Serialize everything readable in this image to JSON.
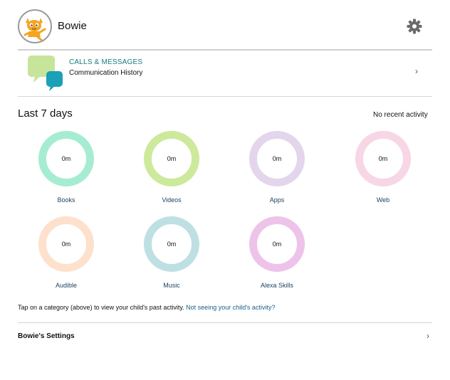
{
  "header": {
    "name": "Bowie",
    "avatar_icon": "cartoon-cat-avatar-icon",
    "settings_icon": "gear-icon"
  },
  "calls": {
    "title": "CALLS & MESSAGES",
    "subtitle": "Communication History",
    "chevron": "›"
  },
  "activity": {
    "title": "Last 7 days",
    "status": "No recent activity"
  },
  "categories": [
    {
      "label": "Books",
      "value": "0m",
      "color": "#a6ecd2"
    },
    {
      "label": "Videos",
      "value": "0m",
      "color": "#cde99b"
    },
    {
      "label": "Apps",
      "value": "0m",
      "color": "#e3d6ec"
    },
    {
      "label": "Web",
      "value": "0m",
      "color": "#f7d6e6"
    },
    {
      "label": "Audible",
      "value": "0m",
      "color": "#fde1cc"
    },
    {
      "label": "Music",
      "value": "0m",
      "color": "#bfe0e3"
    },
    {
      "label": "Alexa Skills",
      "value": "0m",
      "color": "#eec3ea"
    }
  ],
  "help": {
    "text": "Tap on a category (above) to view your child's past activity.",
    "link": "Not seeing your child's activity?"
  },
  "settings": {
    "label": "Bowie's Settings",
    "chevron": "›"
  }
}
